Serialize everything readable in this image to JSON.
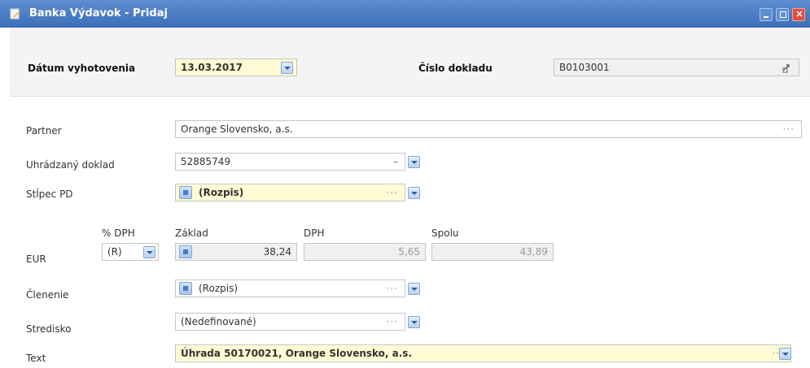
{
  "window": {
    "title": "Banka Výdavok - Pridaj",
    "controls": [
      "minimize",
      "maximize",
      "close"
    ]
  },
  "header": {
    "date_label": "Dátum vyhotovenia",
    "date_value": "13.03.2017",
    "doc_label": "Číslo dokladu",
    "doc_value": "B0103001",
    "doc_icon": "link-icon"
  },
  "form": {
    "partner": {
      "label": "Partner",
      "value": "Orange Slovensko, a.s."
    },
    "paid_doc": {
      "label": "Uhrádzaný doklad",
      "value": "52885749"
    },
    "column": {
      "label": "Stĺpec PD",
      "value": "(Rozpis)"
    },
    "vat": {
      "currency_label": "EUR",
      "rate_label": "% DPH",
      "rate_value": "(R)",
      "base_label": "Základ",
      "base_value": "38,24",
      "vat_label": "DPH",
      "vat_value": "5,65",
      "total_label": "Spolu",
      "total_value": "43,89"
    },
    "division": {
      "label": "Členenie",
      "value": "(Rozpis)"
    },
    "center": {
      "label": "Stredisko",
      "value": "(Nedefinované)"
    },
    "text": {
      "label": "Text",
      "value": "Úhrada 50170021, Orange Slovensko, a.s."
    }
  },
  "colors": {
    "titlebar": "#4a7cc4",
    "required_field": "#fffbd4",
    "readonly_field": "#f0f0f0",
    "header_panel": "#f4f4f4"
  }
}
